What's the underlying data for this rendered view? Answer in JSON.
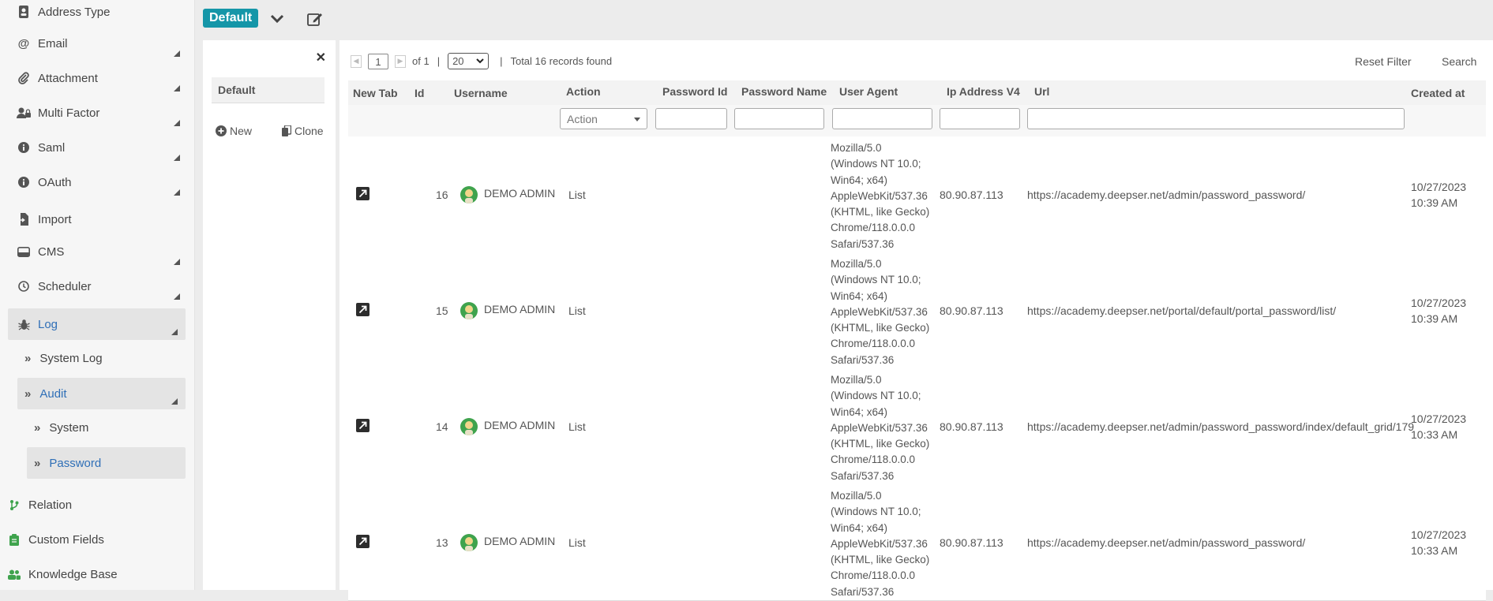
{
  "sidebar": {
    "items": [
      {
        "label": "Address Type",
        "icon": "contact-card-icon"
      },
      {
        "label": "Email",
        "icon": "at-sign-icon"
      },
      {
        "label": "Attachment",
        "icon": "paperclip-icon"
      },
      {
        "label": "Multi Factor",
        "icon": "user-lock-icon"
      },
      {
        "label": "Saml",
        "icon": "info-circle-icon"
      },
      {
        "label": "OAuth",
        "icon": "info-circle-icon"
      },
      {
        "label": "Import",
        "icon": "file-import-icon"
      },
      {
        "label": "CMS",
        "icon": "hard-drive-icon"
      },
      {
        "label": "Scheduler",
        "icon": "clock-icon"
      },
      {
        "label": "Log",
        "icon": "bug-icon"
      }
    ],
    "log_children": [
      {
        "label": "System Log"
      },
      {
        "label": "Audit"
      }
    ],
    "audit_children": [
      {
        "label": "System"
      },
      {
        "label": "Password"
      }
    ],
    "bottom_items": [
      {
        "label": "Relation",
        "icon": "branch-icon"
      },
      {
        "label": "Custom Fields",
        "icon": "clipboard-icon"
      },
      {
        "label": "Knowledge Base",
        "icon": "users-icon"
      }
    ]
  },
  "topbar": {
    "view_badge": "Default"
  },
  "views_panel": {
    "title": "Default",
    "new_label": "New",
    "clone_label": "Clone"
  },
  "toolbar": {
    "page_value": "1",
    "of_label": "of 1",
    "separator": "|",
    "page_size": "20",
    "total_text": "Total 16 records found",
    "reset_filter_label": "Reset Filter",
    "search_label": "Search"
  },
  "columns": [
    "New Tab",
    "Id",
    "Username",
    "Action",
    "Password Id",
    "Password Name",
    "User Agent",
    "Ip Address V4",
    "Url",
    "Created at"
  ],
  "filters": {
    "action_placeholder": "Action"
  },
  "rows": [
    {
      "id": "16",
      "username": "DEMO ADMIN",
      "action": "List",
      "user_agent": [
        "Mozilla/5.0",
        "(Windows NT 10.0;",
        "Win64; x64)",
        "AppleWebKit/537.36",
        "(KHTML, like Gecko)",
        "Chrome/118.0.0.0",
        "Safari/537.36"
      ],
      "ip": "80.90.87.113",
      "url": "https://academy.deepser.net/admin/password_password/",
      "created_date": "10/27/2023",
      "created_time": "10:39 AM"
    },
    {
      "id": "15",
      "username": "DEMO ADMIN",
      "action": "List",
      "user_agent": [
        "Mozilla/5.0",
        "(Windows NT 10.0;",
        "Win64; x64)",
        "AppleWebKit/537.36",
        "(KHTML, like Gecko)",
        "Chrome/118.0.0.0",
        "Safari/537.36"
      ],
      "ip": "80.90.87.113",
      "url": "https://academy.deepser.net/portal/default/portal_password/list/",
      "created_date": "10/27/2023",
      "created_time": "10:39 AM"
    },
    {
      "id": "14",
      "username": "DEMO ADMIN",
      "action": "List",
      "user_agent": [
        "Mozilla/5.0",
        "(Windows NT 10.0;",
        "Win64; x64)",
        "AppleWebKit/537.36",
        "(KHTML, like Gecko)",
        "Chrome/118.0.0.0",
        "Safari/537.36"
      ],
      "ip": "80.90.87.113",
      "url": "https://academy.deepser.net/admin/password_password/index/default_grid/179",
      "created_date": "10/27/2023",
      "created_time": "10:33 AM"
    },
    {
      "id": "13",
      "username": "DEMO ADMIN",
      "action": "List",
      "user_agent": [
        "Mozilla/5.0",
        "(Windows NT 10.0;",
        "Win64; x64)",
        "AppleWebKit/537.36",
        "(KHTML, like Gecko)",
        "Chrome/118.0.0.0",
        "Safari/537.36"
      ],
      "ip": "80.90.87.113",
      "url": "https://academy.deepser.net/admin/password_password/",
      "created_date": "10/27/2023",
      "created_time": "10:33 AM"
    }
  ],
  "colors": {
    "accent": "#1596a8",
    "link_blue": "#2f6fb7",
    "highlight_bg": "#e4e4e4"
  }
}
